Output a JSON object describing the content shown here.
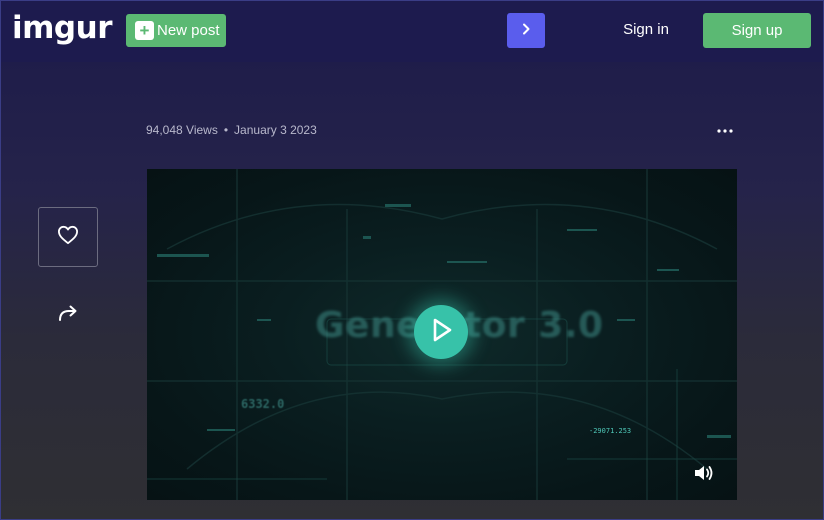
{
  "header": {
    "logo_text": "imgur",
    "new_post_label": "New post",
    "new_post_icon": "plus-icon",
    "next_icon": "chevron-right-icon",
    "sign_in_label": "Sign in",
    "sign_up_label": "Sign up"
  },
  "post": {
    "views": "94,048 Views",
    "separator": "•",
    "date": "January 3 2023",
    "more_icon": "more-horizontal-icon"
  },
  "actions": {
    "like_icon": "heart-icon",
    "share_icon": "share-arrow-icon"
  },
  "video": {
    "title_text": "Generator 3.0",
    "overlay_number_1": "6332.0",
    "overlay_number_2": "-29071.253",
    "play_icon": "play-icon",
    "volume_icon": "volume-icon"
  },
  "colors": {
    "header_bg": "#1d1b4e",
    "green_button": "#5bb973",
    "blue_button": "#5a5ded",
    "play_button": "#37c2a9"
  }
}
